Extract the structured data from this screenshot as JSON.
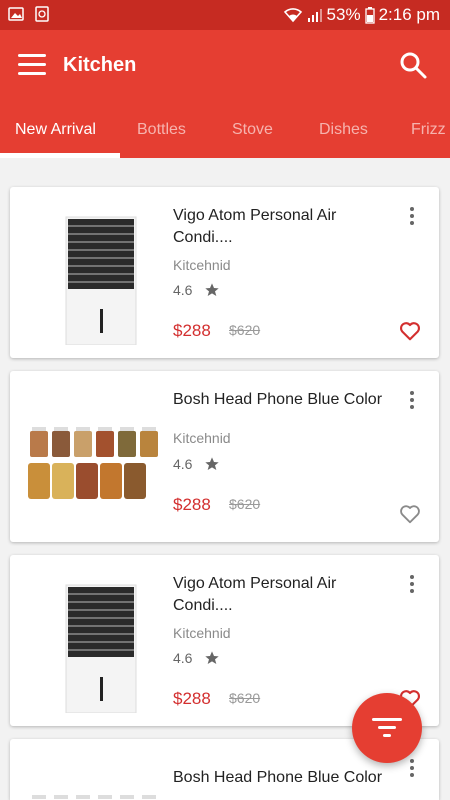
{
  "status_bar": {
    "battery": "53%",
    "time": "2:16 pm"
  },
  "app_bar": {
    "title": "Kitchen"
  },
  "tabs": [
    {
      "label": "New Arrival",
      "active": true
    },
    {
      "label": "Bottles",
      "active": false
    },
    {
      "label": "Stove",
      "active": false
    },
    {
      "label": "Dishes",
      "active": false
    },
    {
      "label": "Frizz",
      "active": false
    }
  ],
  "products": [
    {
      "name": "Vigo Atom Personal Air Condi....",
      "brand": "Kitcehnid",
      "rating": "4.6",
      "price": "$288",
      "old_price": "$620",
      "favorite": true,
      "image": "air-cooler"
    },
    {
      "name": "Bosh Head Phone Blue Color",
      "brand": "Kitcehnid",
      "rating": "4.6",
      "price": "$288",
      "old_price": "$620",
      "favorite": false,
      "image": "spice-jars"
    },
    {
      "name": "Vigo Atom Personal Air Condi....",
      "brand": "Kitcehnid",
      "rating": "4.6",
      "price": "$288",
      "old_price": "$620",
      "favorite": true,
      "image": "air-cooler"
    },
    {
      "name": "Bosh Head Phone Blue Color",
      "image": "spice-jars"
    }
  ],
  "colors": {
    "primary": "#e53e32",
    "status_bar": "#c62b22",
    "price": "#d32f2f"
  },
  "icons": [
    "menu-icon",
    "search-icon",
    "more-vert-icon",
    "star-icon",
    "heart-icon",
    "filter-icon"
  ]
}
